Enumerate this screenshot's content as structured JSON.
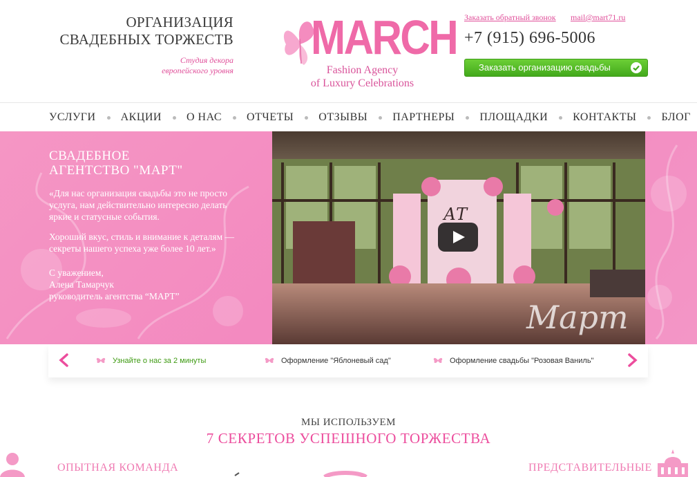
{
  "header": {
    "tagline_line1": "ОРГАНИЗАЦИЯ",
    "tagline_line2": "СВАДЕБНЫХ ТОРЖЕСТВ",
    "subtag_line1": "Студия декора",
    "subtag_line2": "европейского уровня",
    "logo_word": "MARCH",
    "logo_line1": "Fashion Agency",
    "logo_line2": "of Luxury Celebrations",
    "callback_link": "Заказать обратный звонок",
    "email_link": "mail@mart71.ru",
    "phone": "+7 (915) 696-5006",
    "order_button": "Заказать организацию свадьбы"
  },
  "nav": {
    "items": [
      "УСЛУГИ",
      "АКЦИИ",
      "О НАС",
      "ОТЧЕТЫ",
      "ОТЗЫВЫ",
      "ПАРТНЕРЫ",
      "ПЛОЩАДКИ",
      "КОНТАКТЫ",
      "БЛОГ"
    ]
  },
  "hero": {
    "title_line1": "СВАДЕБНОЕ",
    "title_line2": "АГЕНТСТВО \"МАРТ\"",
    "quote": "«Для нас организация свадьбы это не просто услуга, нам действительно интересно делать яркие и статусные события.",
    "quote2": "Хороший вкус, стиль и внимание к деталям — секреты нашего успеха уже более 10 лет.»",
    "sign_line1": "С уважением,",
    "sign_line2": "Алена Тамарчук",
    "sign_line3": "руководитель агентства “МАРТ”",
    "video_watermark": "Март",
    "monogram": "АТ"
  },
  "slider": {
    "items": [
      {
        "label": "Узнайте о нас за 2 минуты",
        "active": true
      },
      {
        "label": "Оформление \"Яблоневый сад\"",
        "active": false
      },
      {
        "label": "Оформление свадьбы \"Розовая Ваниль\"",
        "active": false
      }
    ]
  },
  "secrets": {
    "kicker": "МЫ ИСПОЛЬЗУЕМ",
    "title": "7 СЕКРЕТОВ УСПЕШНОГО ТОРЖЕСТВА",
    "left_feature": "ОПЫТНАЯ КОМАНДА",
    "right_feature": "ПРЕДСТАВИТЕЛЬНЫЕ"
  },
  "colors": {
    "brand_pink": "#ec4d9d",
    "hero_pink": "#f38ac0",
    "button_green": "#4cb423"
  },
  "icons": [
    "butterfly-logo-icon",
    "check-icon",
    "play-icon",
    "chevron-left-icon",
    "chevron-right-icon",
    "butterfly-bullet-icon",
    "person-icon",
    "building-icon"
  ]
}
